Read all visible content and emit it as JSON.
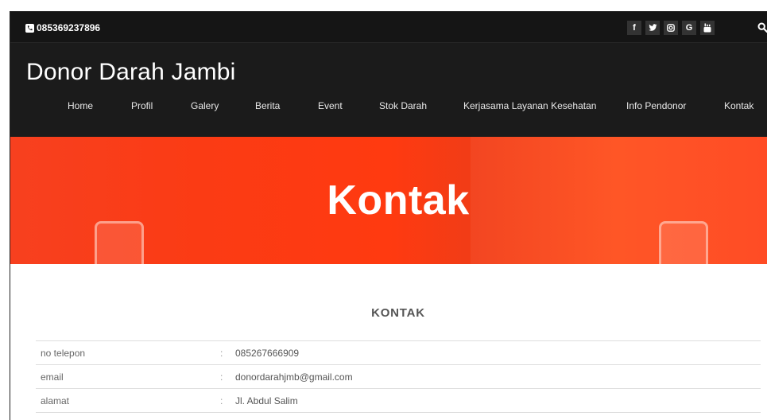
{
  "topbar": {
    "phone": "085369237896",
    "socials": [
      {
        "icon": "facebook-icon",
        "glyph": "f"
      },
      {
        "icon": "twitter-icon",
        "glyph": "✉"
      },
      {
        "icon": "instagram-icon",
        "glyph": "◎"
      },
      {
        "icon": "google-icon",
        "glyph": "G"
      },
      {
        "icon": "youtube-icon",
        "glyph": "▶"
      }
    ]
  },
  "header": {
    "brand": "Donor Darah Jambi",
    "nav": [
      "Home",
      "Profil",
      "Galery",
      "Berita",
      "Event",
      "Stok Darah",
      "Kerjasama Layanan Kesehatan",
      "Info Pendonor",
      "Kontak"
    ]
  },
  "hero": {
    "title": "Kontak"
  },
  "contact": {
    "section_title": "KONTAK",
    "separator": ":",
    "rows": [
      {
        "label": "no telepon",
        "value": "085267666909"
      },
      {
        "label": "email",
        "value": "donordarahjmb@gmail.com"
      },
      {
        "label": "alamat",
        "value": "Jl. Abdul Salim"
      }
    ]
  },
  "colors": {
    "topbar_bg": "#151515",
    "header_bg": "#1b1b1b",
    "hero_red": "#ff3a10"
  }
}
